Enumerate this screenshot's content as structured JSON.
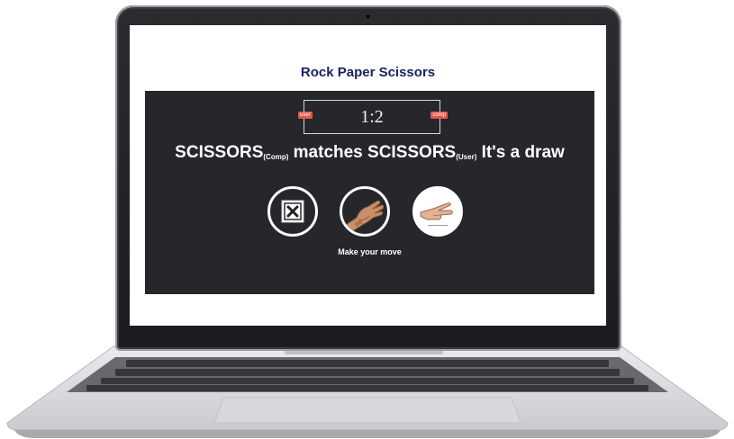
{
  "app": {
    "title": "Rock Paper Scissors"
  },
  "scoreboard": {
    "score": "1:2",
    "user_badge": "user",
    "comp_badge": "comp"
  },
  "result": {
    "comp_choice": "SCISSORS",
    "comp_tag": "(Comp)",
    "connector": " matches ",
    "user_choice": "SCISSORS",
    "user_tag": "(User)",
    "outcome": " It's a draw"
  },
  "choices": [
    {
      "id": "rock",
      "icon": "x-box-icon"
    },
    {
      "id": "paper",
      "icon": "open-hand-icon"
    },
    {
      "id": "scissors",
      "icon": "scissors-hand-icon"
    }
  ],
  "prompt": "Make your move",
  "colors": {
    "title": "#1d2160",
    "panel": "#25272b",
    "badge": "#e2574c"
  }
}
